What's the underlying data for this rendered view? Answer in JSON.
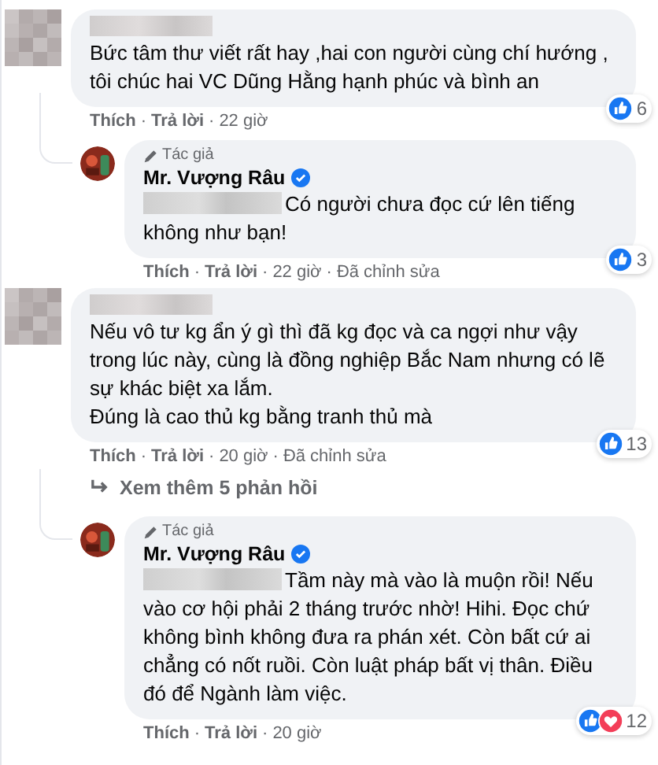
{
  "separator": "·",
  "comments": [
    {
      "kind": "top",
      "author_blurred": true,
      "paragraphs": [
        "Bức tâm thư viết rất hay ,hai con người cùng chí hướng , tôi chúc hai VC Dũng Hằng hạnh phúc và bình an"
      ],
      "reactions": [
        {
          "kind": "like"
        }
      ],
      "reaction_count": "6",
      "actions": [
        {
          "label": "Thích",
          "kind": "link"
        },
        {
          "label": "Trả lời",
          "kind": "link"
        },
        {
          "label": "22 giờ",
          "kind": "meta"
        }
      ]
    },
    {
      "kind": "reply",
      "badge": "Tác giả",
      "name": "Mr. Vượng Râu",
      "verified": true,
      "mention_blurred": true,
      "paragraphs": [
        "Có người chưa đọc cứ lên tiếng không như bạn!"
      ],
      "reactions": [
        {
          "kind": "like"
        }
      ],
      "reaction_count": "3",
      "actions": [
        {
          "label": "Thích",
          "kind": "link"
        },
        {
          "label": "Trả lời",
          "kind": "link"
        },
        {
          "label": "22 giờ",
          "kind": "meta"
        },
        {
          "label": "Đã chỉnh sửa",
          "kind": "meta"
        }
      ]
    },
    {
      "kind": "top",
      "author_blurred": true,
      "paragraphs": [
        "Nếu vô tư kg ẩn ý gì thì đã kg đọc và ca ngợi như vậy trong lúc này, cùng là đồng nghiệp Bắc Nam nhưng có lẽ sự khác biệt xa lắm.",
        "Đúng là cao thủ kg bằng tranh thủ mà"
      ],
      "reactions": [
        {
          "kind": "like"
        }
      ],
      "reaction_count": "13",
      "actions": [
        {
          "label": "Thích",
          "kind": "link"
        },
        {
          "label": "Trả lời",
          "kind": "link"
        },
        {
          "label": "20 giờ",
          "kind": "meta"
        },
        {
          "label": "Đã chỉnh sửa",
          "kind": "meta"
        }
      ]
    },
    {
      "kind": "more",
      "label": "Xem thêm 5 phản hồi"
    },
    {
      "kind": "reply",
      "badge": "Tác giả",
      "name": "Mr. Vượng Râu",
      "verified": true,
      "mention_blurred": true,
      "paragraphs": [
        "Tầm này mà vào là muộn rồi! Nếu vào cơ hội phải 2 tháng trước nhờ! Hihi. Đọc chứ không bình không đưa ra phán xét. Còn bất cứ ai chẳng có nốt ruồi. Còn luật pháp bất vị thân. Điều đó để Ngành làm việc."
      ],
      "reactions": [
        {
          "kind": "like"
        },
        {
          "kind": "love"
        }
      ],
      "reaction_count": "12",
      "actions": [
        {
          "label": "Thích",
          "kind": "link"
        },
        {
          "label": "Trả lời",
          "kind": "link"
        },
        {
          "label": "20 giờ",
          "kind": "meta"
        }
      ]
    }
  ]
}
